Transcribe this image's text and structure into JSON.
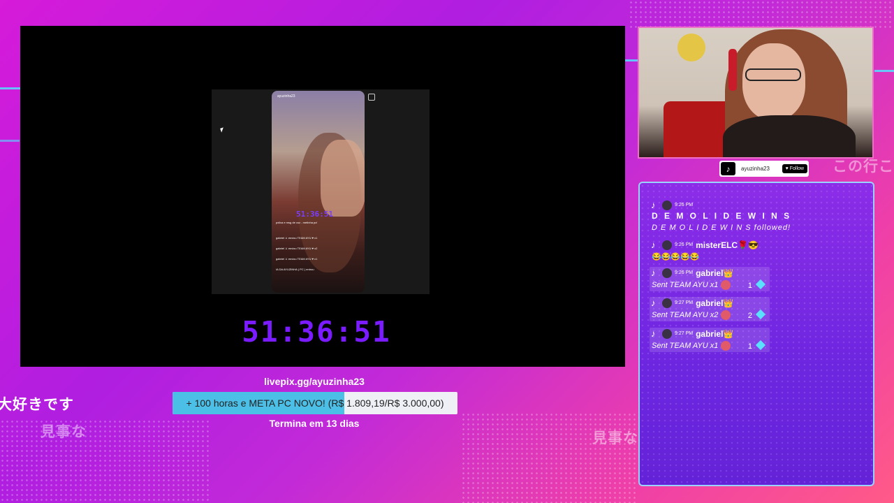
{
  "stream": {
    "timer": "51:36:51",
    "livepix_url": "livepix.gg/ayuzinha23",
    "goal": {
      "label": "+ 100 horas e META PC NOVO! (R$ 1.809,19/R$ 3.000,00)",
      "progress_fraction": 0.603,
      "fill_color": "#4cbfe6"
    },
    "goal_ends": "Termina em 13 dias",
    "bg_text": [
      "大好きです",
      "見事な",
      "見事な",
      "この行こ"
    ]
  },
  "phone": {
    "username": "ayuzinha23",
    "timer": "51:36:51",
    "caption": "pxliva e msg de voz - metinha pc!",
    "rows": [
      "gabriel ⚔ enviou TEAM AYU ♥ x1",
      "gabriel ⚔ enviou TEAM AYU ♥ x2",
      "gabriel ⚔ enviou TEAM AYU ♥ x1",
      "IA DA AYUZINHA ( PC ) entrou"
    ]
  },
  "tiktok_tag": {
    "icon": "tiktok-icon",
    "username": "ayuzinha23",
    "follow_label": "♥ Follow"
  },
  "chat": {
    "messages": [
      {
        "time": "9:26 PM",
        "user": "D E M O L I D E W I N S",
        "text": "D E M O L I D E W I N S followed!",
        "type": "follow"
      },
      {
        "time": "9:26 PM",
        "user": "misterELC🌹😎",
        "text": "😂😂😂😂😂",
        "type": "comment"
      },
      {
        "time": "9:26 PM",
        "user": "gabriel👑",
        "text": "Sent TEAM AYU x1",
        "count": "1",
        "type": "gift"
      },
      {
        "time": "9:27 PM",
        "user": "gabriel👑",
        "text": "Sent TEAM AYU x2",
        "count": "2",
        "type": "gift"
      },
      {
        "time": "9:27 PM",
        "user": "gabriel👑",
        "text": "Sent TEAM AYU x1",
        "count": "1",
        "type": "gift"
      }
    ]
  },
  "colors": {
    "timer": "#7a1cff",
    "chat_bg": "#6d26e0",
    "chat_border": "#9ad3ff",
    "cam_border": "#ef6ec8"
  }
}
